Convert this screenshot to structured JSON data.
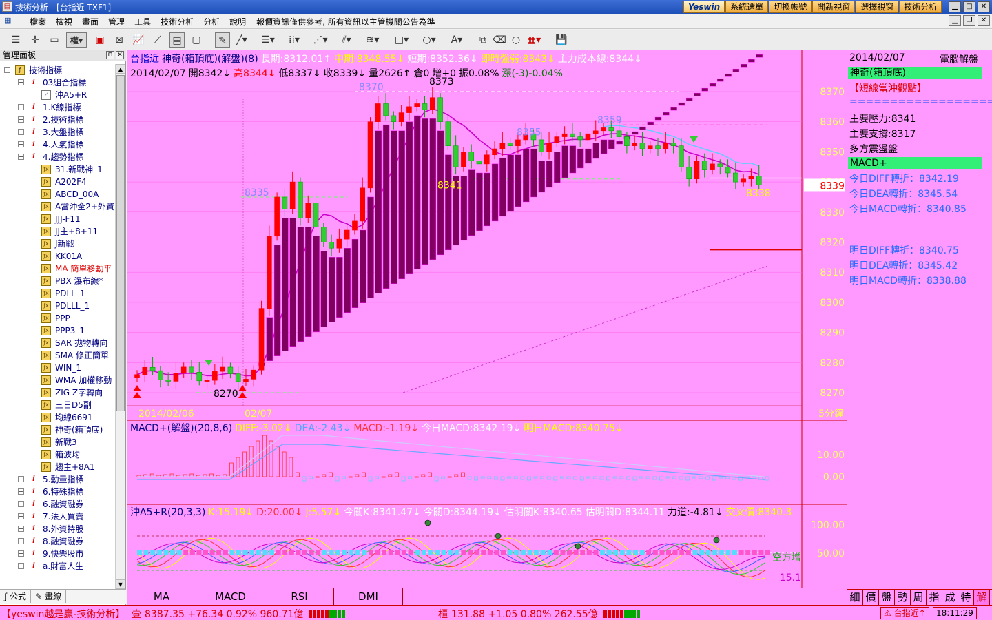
{
  "window": {
    "title": "技術分析 - [台指近 TXF1]",
    "brand_button": "Yeswin",
    "quick_buttons": [
      "系統選單",
      "切換帳號",
      "開新視窗",
      "選擇視窗",
      "技術分析"
    ]
  },
  "menu": {
    "items": [
      "檔案",
      "檢視",
      "畫面",
      "管理",
      "工具",
      "技術分析",
      "分析",
      "說明"
    ],
    "notice": "報價資訊僅供參考, 所有資訊以主管機關公告為準"
  },
  "toolbar": {
    "period_label": "權"
  },
  "panel": {
    "title": "管理面板",
    "tree": [
      {
        "label": "技術指標",
        "level": 0,
        "icon": "root",
        "exp": "-"
      },
      {
        "label": "03組合指標",
        "level": 1,
        "icon": "grp",
        "exp": "-"
      },
      {
        "label": "沖A5+R",
        "level": 2,
        "icon": "chart",
        "exp": ""
      },
      {
        "label": "1.K線指標",
        "level": 1,
        "icon": "grp",
        "exp": "+"
      },
      {
        "label": "2.技術指標",
        "level": 1,
        "icon": "grp",
        "exp": "+"
      },
      {
        "label": "3.大盤指標",
        "level": 1,
        "icon": "grp",
        "exp": "+"
      },
      {
        "label": "4.人氣指標",
        "level": 1,
        "icon": "grp",
        "exp": "+"
      },
      {
        "label": "4.趨勢指標",
        "level": 1,
        "icon": "grp",
        "exp": "-"
      },
      {
        "label": "31.新戰神_1",
        "level": 2,
        "icon": "fx",
        "exp": ""
      },
      {
        "label": "A202F4",
        "level": 2,
        "icon": "fx",
        "exp": ""
      },
      {
        "label": "ABCD_00A",
        "level": 2,
        "icon": "fx",
        "exp": ""
      },
      {
        "label": "A當沖全2+外資",
        "level": 2,
        "icon": "fx",
        "exp": ""
      },
      {
        "label": "JJJ-F11",
        "level": 2,
        "icon": "fx",
        "exp": ""
      },
      {
        "label": "JJ主+8+11",
        "level": 2,
        "icon": "fx",
        "exp": ""
      },
      {
        "label": "J新戰",
        "level": 2,
        "icon": "fx",
        "exp": ""
      },
      {
        "label": "KK01A",
        "level": 2,
        "icon": "fx",
        "exp": ""
      },
      {
        "label": "MA 簡單移動平",
        "level": 2,
        "icon": "fx",
        "exp": "",
        "red": true
      },
      {
        "label": "PBX 瀑布線*",
        "level": 2,
        "icon": "fx",
        "exp": ""
      },
      {
        "label": "PDLL_1",
        "level": 2,
        "icon": "fx",
        "exp": ""
      },
      {
        "label": "PDLLL_1",
        "level": 2,
        "icon": "fx",
        "exp": ""
      },
      {
        "label": "PPP",
        "level": 2,
        "icon": "fx",
        "exp": ""
      },
      {
        "label": "PPP3_1",
        "level": 2,
        "icon": "fx",
        "exp": ""
      },
      {
        "label": "SAR 拋物轉向",
        "level": 2,
        "icon": "fx",
        "exp": ""
      },
      {
        "label": "SMA 修正簡單",
        "level": 2,
        "icon": "fx",
        "exp": ""
      },
      {
        "label": "WIN_1",
        "level": 2,
        "icon": "fx",
        "exp": ""
      },
      {
        "label": "WMA 加權移動",
        "level": 2,
        "icon": "fx",
        "exp": ""
      },
      {
        "label": "ZIG Z字轉向",
        "level": 2,
        "icon": "fx",
        "exp": ""
      },
      {
        "label": "三日D5副",
        "level": 2,
        "icon": "fx",
        "exp": ""
      },
      {
        "label": "均線6691",
        "level": 2,
        "icon": "fx",
        "exp": ""
      },
      {
        "label": "神奇(箱頂底)",
        "level": 2,
        "icon": "fx",
        "exp": ""
      },
      {
        "label": "新戰3",
        "level": 2,
        "icon": "fx",
        "exp": ""
      },
      {
        "label": "箱波均",
        "level": 2,
        "icon": "fx",
        "exp": ""
      },
      {
        "label": "趨主+8A1",
        "level": 2,
        "icon": "fx",
        "exp": ""
      },
      {
        "label": "5.動量指標",
        "level": 1,
        "icon": "grp",
        "exp": "+"
      },
      {
        "label": "6.特殊指標",
        "level": 1,
        "icon": "grp",
        "exp": "+"
      },
      {
        "label": "6.融資融券",
        "level": 1,
        "icon": "grp",
        "exp": "+"
      },
      {
        "label": "7.法人買賣",
        "level": 1,
        "icon": "grp",
        "exp": "+"
      },
      {
        "label": "8.外資持股",
        "level": 1,
        "icon": "grp",
        "exp": "+"
      },
      {
        "label": "8.融資融券",
        "level": 1,
        "icon": "grp",
        "exp": "+"
      },
      {
        "label": "9.快樂股市",
        "level": 1,
        "icon": "grp",
        "exp": "+"
      },
      {
        "label": "a.財富人生",
        "level": 1,
        "icon": "grp",
        "exp": "+"
      }
    ],
    "tabs": [
      "公式",
      "畫線"
    ]
  },
  "main_chart": {
    "header_symbol": "台指近",
    "header_indicator": "神奇(箱頂底)(解盤)(8)",
    "header_values": [
      {
        "text": "長期:8312.01↑",
        "color": "#ffffff"
      },
      {
        "text": "中期:8348.55↓",
        "color": "#ffff00"
      },
      {
        "text": "短期:8352.36↓",
        "color": "#ffffff"
      },
      {
        "text": "即時強弱:8343↓",
        "color": "#ffff00"
      },
      {
        "text": "主力成本線:8344↓",
        "color": "#ffffff"
      }
    ],
    "ohlc_date": "2014/02/07",
    "ohlc": [
      {
        "text": "開8342↓",
        "color": "#000000"
      },
      {
        "text": "高8344↓",
        "color": "#ff0000"
      },
      {
        "text": "低8337↓",
        "color": "#000000"
      },
      {
        "text": "收8339↓",
        "color": "#000000"
      },
      {
        "text": "量2626↑",
        "color": "#000000"
      },
      {
        "text": "倉0",
        "color": "#000000"
      },
      {
        "text": "增+0",
        "color": "#000000"
      },
      {
        "text": "振0.08%",
        "color": "#000000"
      },
      {
        "text": "漲(-3)-0.04%",
        "color": "#007700"
      }
    ],
    "price_ticks": [
      "8370",
      "8360",
      "8350",
      "8340",
      "8330",
      "8320",
      "8310",
      "8300",
      "8290",
      "8280",
      "8270"
    ],
    "current_price": "8339",
    "date_labels": [
      "2014/02/06",
      "02/07"
    ],
    "period_label": "5分鐘",
    "annotations": [
      {
        "text": "8373",
        "color": "#000000"
      },
      {
        "text": "8370",
        "color": "#8888ff"
      },
      {
        "text": "8359",
        "color": "#8888ff"
      },
      {
        "text": "8355",
        "color": "#8888ff"
      },
      {
        "text": "8341",
        "color": "#ffff00"
      },
      {
        "text": "8335",
        "color": "#8888ff"
      },
      {
        "text": "8338",
        "color": "#ffff00"
      },
      {
        "text": "8270",
        "color": "#000000"
      }
    ]
  },
  "macd_chart": {
    "title": "MACD+(解盤)(20,8,6)",
    "values": [
      {
        "text": "DIFF:-3.02↓",
        "color": "#ffff00"
      },
      {
        "text": "DEA:-2.43↓",
        "color": "#4da6ff"
      },
      {
        "text": "MACD:-1.19↓",
        "color": "#ff3333"
      },
      {
        "text": "今日MACD:8342.19↓",
        "color": "#ffffff"
      },
      {
        "text": "明日MACD:8340.75↓",
        "color": "#ffff00"
      }
    ],
    "ticks": [
      "10.00",
      "0.00"
    ]
  },
  "kd_chart": {
    "title": "沖A5+R(20,3,3)",
    "values": [
      {
        "text": "K:15.19↓",
        "color": "#ffff00"
      },
      {
        "text": "D:20.00↓",
        "color": "#ff3333"
      },
      {
        "text": "J:5.57↓",
        "color": "#ffff00"
      },
      {
        "text": "今關K:8341.47↓",
        "color": "#ffffff"
      },
      {
        "text": "今關D:8344.19↓",
        "color": "#ffffff"
      },
      {
        "text": "估明關K:8340.65",
        "color": "#ffffff"
      },
      {
        "text": "估明關D:8344.11",
        "color": "#ffffff"
      },
      {
        "text": "力道:-4.81↓",
        "color": "#000000"
      },
      {
        "text": "交叉價:8340.3",
        "color": "#ffff00"
      }
    ],
    "ticks": [
      "100.00",
      "50.00"
    ],
    "label_empty": "空方增",
    "last_value": "15.1"
  },
  "bottom_tabs": [
    "MA",
    "MACD",
    "RSI",
    "DMI"
  ],
  "right_panel": {
    "date": "2014/02/07",
    "title": "電腦解盤",
    "section1": "神奇(箱頂底)",
    "view_label": "【短線當沖觀點】",
    "separator": "===================",
    "lines1": [
      "主要壓力:8341",
      "主要支撐:8317",
      "多方震盪盤"
    ],
    "section2": "MACD+",
    "today": [
      "今日DIFF轉折：8342.19",
      "今日DEA轉折：8345.54",
      "今日MACD轉折：8340.85"
    ],
    "tomorrow": [
      "明日DIFF轉折：8340.75",
      "明日DEA轉折：8345.42",
      "明日MACD轉折：8338.88"
    ],
    "tabs": [
      "細",
      "價",
      "盤",
      "勢",
      "周",
      "指",
      "成",
      "特",
      "解"
    ]
  },
  "statusbar": {
    "brand": "【yeswin越是贏-技術分析】",
    "idx1_name": "壹",
    "idx1_value": "8387.35 +76.34 0.92% 960.71億",
    "idx2_name": "櫃",
    "idx2_value": "131.88 +1.05 0.80% 262.55億",
    "symbol": "台指近↑",
    "time": "18:11:29"
  },
  "colors": {
    "background": "#ff99ff",
    "up": "#ff0000",
    "down": "#33cc33",
    "body": "#800060",
    "highlight": "#33ee77"
  }
}
